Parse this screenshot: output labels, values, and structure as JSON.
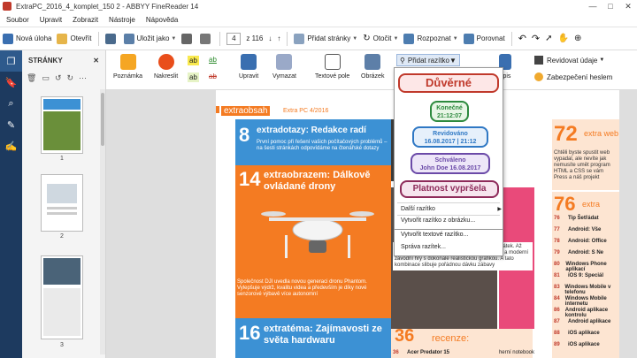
{
  "window": {
    "title": "ExtraPC_2016_4_komplet_150 2 - ABBYY FineReader 14",
    "minimize": "—",
    "maximize": "□",
    "close": "✕"
  },
  "menu": [
    "Soubor",
    "Upravit",
    "Zobrazit",
    "Nástroje",
    "Nápověda"
  ],
  "toolbar": {
    "new_task": "Nová úloha",
    "open": "Otevřít",
    "save_as": "Uložit jako",
    "page_value": "4",
    "page_total": "z 116",
    "add_pages": "Přidat stránky",
    "rotate": "Otočit",
    "recognize": "Rozpoznat",
    "compare": "Porovnat"
  },
  "panel": {
    "title": "STRÁNKY",
    "pages": [
      "1",
      "2",
      "3"
    ]
  },
  "ribbon": {
    "note": "Poznámka",
    "draw": "Nakreslit",
    "edit": "Upravit",
    "erase": "Vymazat",
    "text_field": "Textové pole",
    "image": "Obrázek",
    "add_stamp": "Přidat razítko",
    "sign_partial": "dpis",
    "review_data": "Revidovat údaje",
    "password_security": "Zabezpečení heslem"
  },
  "stamps": [
    {
      "text": "Důvěrné",
      "color": "#c0392b",
      "bg": "#fde7e7"
    },
    {
      "line1": "Konečné",
      "line2": "21:12:07",
      "color": "#2d8a3e",
      "bg": "#e8f6e6"
    },
    {
      "line1": "Revidováno",
      "line2": "16.08.2017 | 21:12",
      "color": "#2f78c4",
      "bg": "#e6f0fb"
    },
    {
      "line1": "Schváleno",
      "line2": "John Doe 16.08.2017",
      "color": "#6b4aa8",
      "bg": "#ede6f8"
    },
    {
      "text": "Platnost vypršela",
      "color": "#8e2b5a",
      "bg": "#f6e5ee"
    }
  ],
  "stamp_menu": {
    "other": "Další razítko",
    "from_image": "Vytvořit razítko z obrázku...",
    "text_stamp": "Vytvořit textové razítko...",
    "manage": "Správa razítek..."
  },
  "colors": [
    "#ffeb3b",
    "#00bcd4",
    "#e040fb",
    "#3f51b5",
    "#8e24aa"
  ],
  "document": {
    "header_extra": "extraobsah",
    "header_issue": "Extra PC 4/2016",
    "item8_num": "8",
    "item8_title": "extradotazy: Redakce radí",
    "item8_text": "První pomoc při řešení vašich počítačových problémů – na šesti stránkách odpovídáme na čtenářské dotazy",
    "item14_num": "14",
    "item14_title": "extraobrazem: Dálkově ovládané drony",
    "item14_text": "Společnost DJI uvedla novou generaci dronu Phantom. Vylepšuje výdrž, kvalitu videa a především je díky nové senzorové výbavě více autonomní",
    "item16_num": "16",
    "item16_title": "extratéma: Zajímavosti ze světa hardwaru",
    "center_text": "Herní volanty jsou tady s námi už nějaký ten pátek. Až poslední dobou ale máme doma i oba displeje a moderní závodní hry s dokonale realistickou grafikou. A tato kombinace slibuje pořádnou dávku zábavy",
    "item36_num": "36",
    "item36_title": "recenze:",
    "reviews": [
      {
        "n": "36",
        "name": "Acer Predator 15",
        "type": "herní notebook"
      },
      {
        "n": "38",
        "name": "Microsoft Lumia 550",
        "type": "smartphone"
      },
      {
        "n": "39",
        "name": "Huawei Honor 7",
        "type": "smartphone"
      },
      {
        "n": "40",
        "name": "Lynx Grunex ExtremeGamer 2016",
        "type": "herní počítač"
      }
    ],
    "right72": "72",
    "right72_word": "extra web",
    "right72_text": "Chtěli byste spustit web vypadal, ale nevíte jak nemusíte umět program HTML a CSS se vám Press a náš projekt",
    "right76": "76",
    "right76_word": "extra",
    "right_list": [
      {
        "n": "76",
        "t": "Tip Šetřádat"
      },
      {
        "n": "77",
        "t": "Android: Vše"
      },
      {
        "n": "78",
        "t": "Android: Office"
      },
      {
        "n": "79",
        "t": "Android: S Ne"
      },
      {
        "n": "80",
        "t": "Windows Phone aplikací"
      },
      {
        "n": "81",
        "t": "iOS 9: Speciál"
      },
      {
        "n": "83",
        "t": "Windows Mobile v telefonu"
      },
      {
        "n": "84",
        "t": "Windows Mobile internetu"
      },
      {
        "n": "86",
        "t": "Android aplikace kontrolu"
      },
      {
        "n": "87",
        "t": "Android aplikace"
      },
      {
        "n": "88",
        "t": "iOS aplikace"
      },
      {
        "n": "89",
        "t": "iOS aplikace"
      }
    ]
  }
}
